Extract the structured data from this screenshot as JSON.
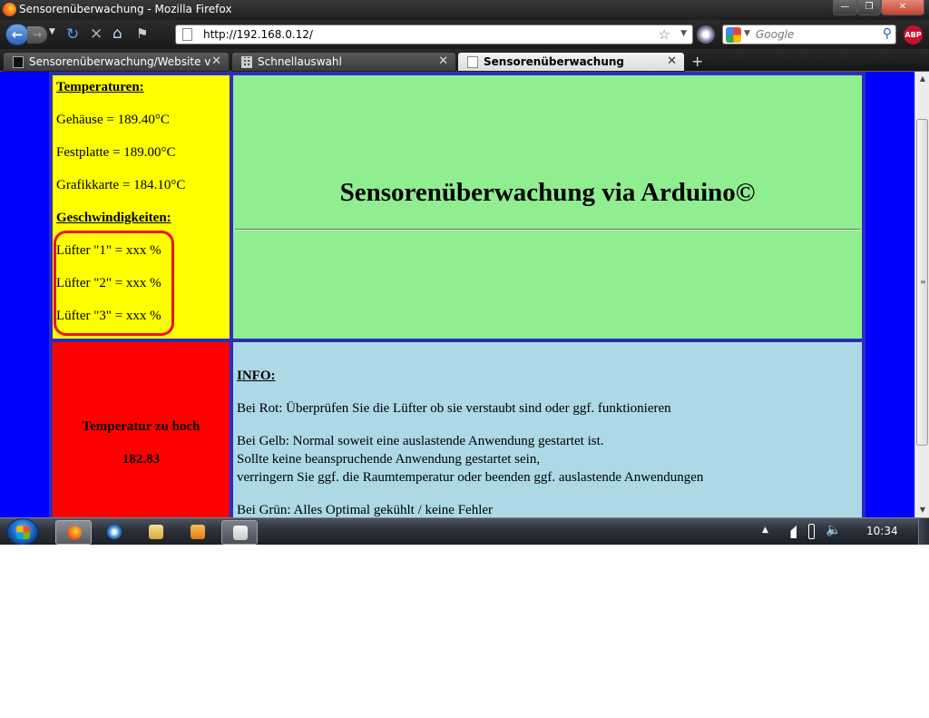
{
  "window": {
    "title": "Sensorenüberwachung - Mozilla Firefox",
    "controls": {
      "minimize": "—",
      "maximize": "❐",
      "close": "✕"
    }
  },
  "toolbar": {
    "url": "http://192.168.0.12/",
    "search_placeholder": "Google",
    "addon_label": "ABP",
    "icons": [
      "back-icon",
      "forward-icon",
      "history-dropdown-icon",
      "reload-icon",
      "stop-icon",
      "home-icon",
      "addon-icon",
      "bookmark-star-icon",
      "persona-icon",
      "google-icon",
      "search-icon",
      "adblock-icon"
    ]
  },
  "tabs": [
    {
      "label": "Sensorenüberwachung/Website via ...",
      "active": false
    },
    {
      "label": "Schnellauswahl",
      "active": false
    },
    {
      "label": "Sensorenüberwachung",
      "active": true
    }
  ],
  "page": {
    "colors": {
      "background": "#0000ff",
      "temps_cell": "#ffff00",
      "title_cell": "#90ee90",
      "warning_cell": "#ff0000",
      "info_cell": "#add8e6",
      "highlight": "#e8141e"
    },
    "temps": {
      "heading": "Temperaturen:",
      "lines": [
        "Gehäuse = 189.40°C",
        "Festplatte = 189.00°C",
        "Grafikkarte = 184.10°C"
      ]
    },
    "speeds": {
      "heading": "Geschwindigkeiten:",
      "lines": [
        "Lüfter \"1\" = xxx %",
        "Lüfter \"2\" = xxx %",
        "Lüfter \"3\" = xxx %"
      ]
    },
    "main_title": "Sensorenüberwachung via Arduino©",
    "warning": {
      "title": "Temperatur zu hoch",
      "value": "182.83"
    },
    "info": {
      "heading": "INFO:",
      "red": "Bei Rot: Überprüfen Sie die Lüfter ob sie verstaubt sind oder ggf. funktionieren",
      "yellow": [
        "Bei Gelb: Normal soweit eine auslastende Anwendung gestartet ist.",
        "Sollte keine beanspruchende Anwendung gestartet sein,",
        "verringern Sie ggf. die Raumtemperatur oder beenden ggf. auslastende Anwendungen"
      ],
      "green": "Bei Grün: Alles Optimal gekühlt / keine Fehler"
    }
  },
  "taskbar": {
    "clock": "10:34",
    "apps": [
      "firefox-icon",
      "internet-explorer-icon",
      "explorer-folder-icon",
      "media-player-icon",
      "java-icon"
    ]
  }
}
